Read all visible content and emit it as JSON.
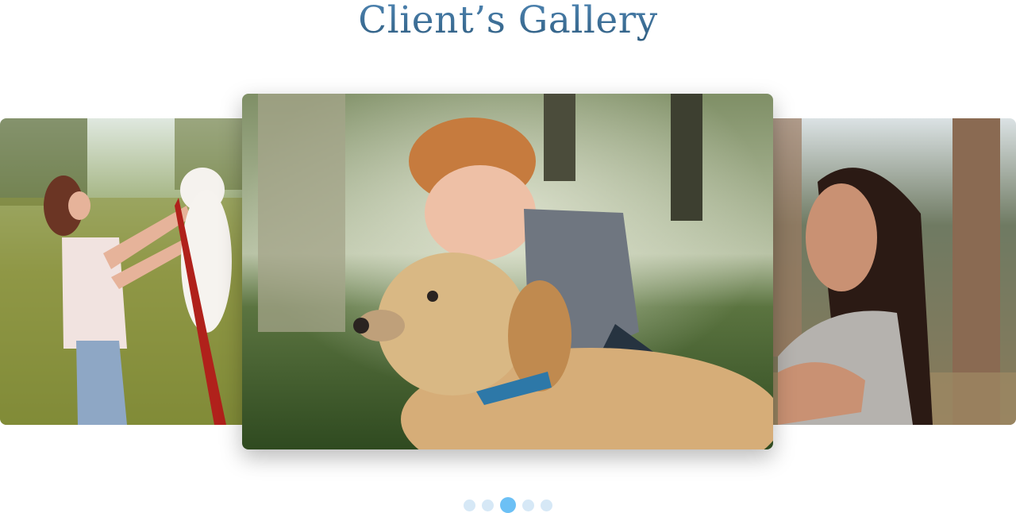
{
  "gallery": {
    "title": "Client’s Gallery",
    "slides": [
      {
        "subject": "woman lifting white dog in meadow"
      },
      {
        "subject": "boy hugging golden doodle dog on grass"
      },
      {
        "subject": "smiling woman outdoors"
      }
    ],
    "pagination": {
      "total": 5,
      "active_index": 3
    }
  },
  "colors": {
    "title": "#3f6f97",
    "dot": "#d6e8f6",
    "dot_active": "#6cc0f5"
  }
}
